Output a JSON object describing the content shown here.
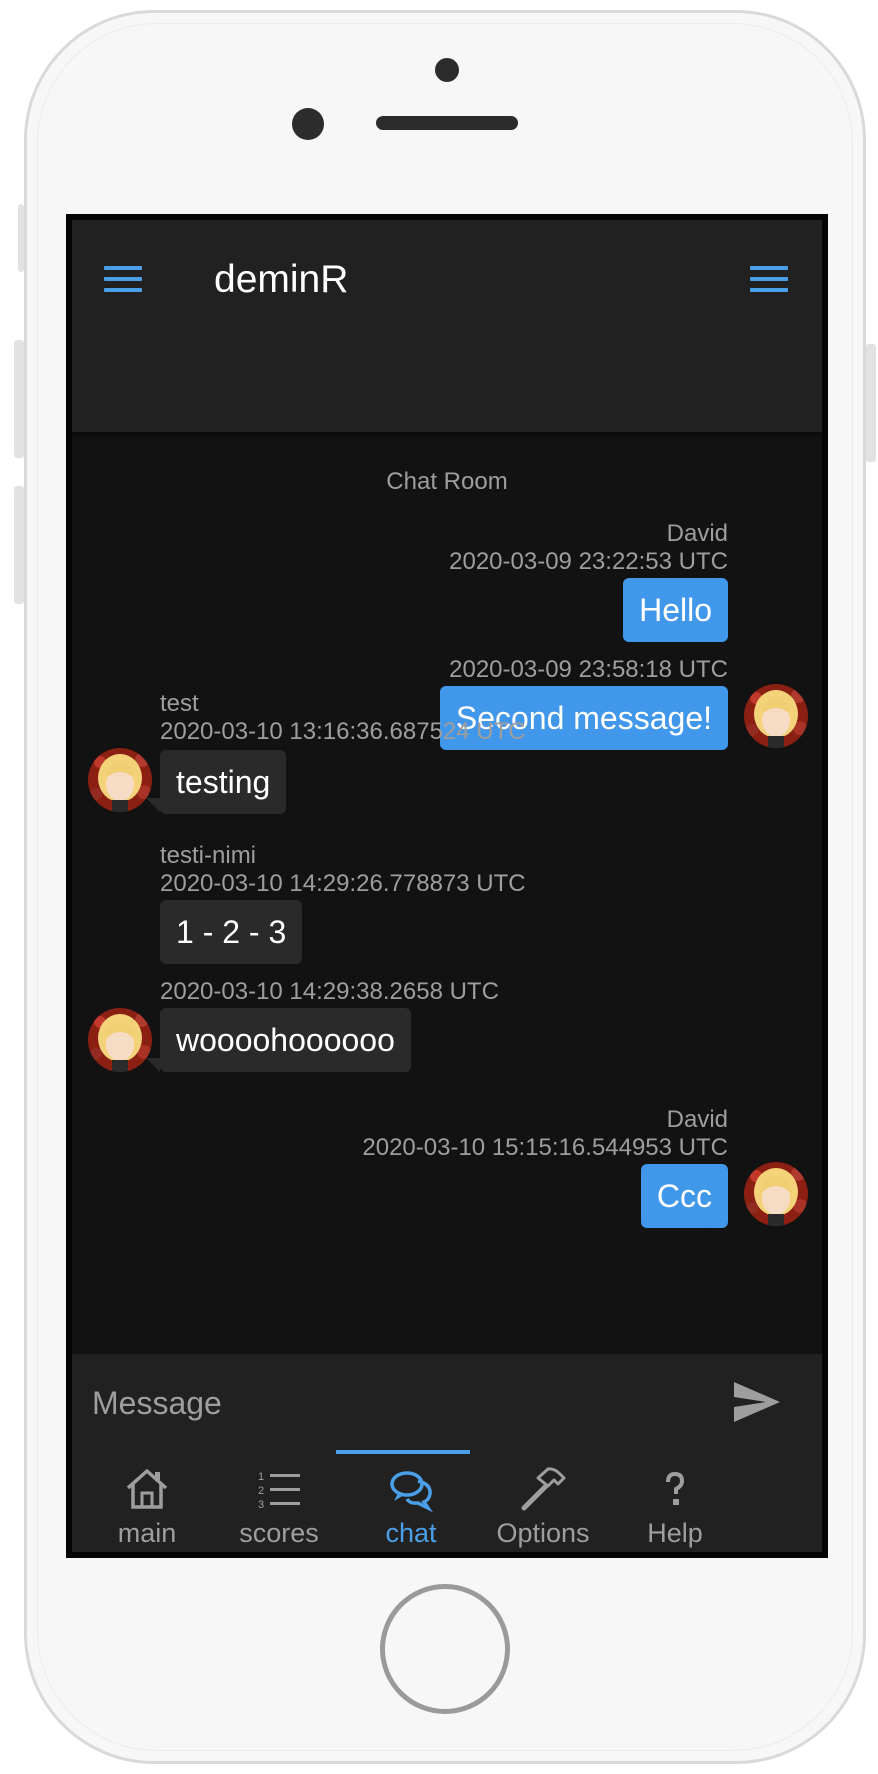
{
  "app": {
    "title": "deminR"
  },
  "chat": {
    "room_title": "Chat Room",
    "messages": [
      {
        "sender": "David",
        "timestamp": "2020-03-09 23:22:53 UTC",
        "text": "Hello",
        "own": true
      },
      {
        "sender": "",
        "timestamp": "2020-03-09 23:58:18 UTC",
        "text": "Second message!",
        "own": true
      },
      {
        "sender": "test",
        "timestamp": "2020-03-10 13:16:36.687524 UTC",
        "text": "testing",
        "own": false
      },
      {
        "sender": "testi-nimi",
        "timestamp": "2020-03-10 14:29:26.778873 UTC",
        "text": "1 - 2 - 3",
        "own": false
      },
      {
        "sender": "",
        "timestamp": "2020-03-10 14:29:38.2658 UTC",
        "text": "woooohoooooo",
        "own": false
      },
      {
        "sender": "David",
        "timestamp": "2020-03-10 15:15:16.544953 UTC",
        "text": "Ccc",
        "own": true
      }
    ]
  },
  "input": {
    "placeholder": "Message",
    "value": ""
  },
  "tabs": [
    {
      "label": "main",
      "icon": "home-icon",
      "active": false
    },
    {
      "label": "scores",
      "icon": "numbered-list-icon",
      "active": false
    },
    {
      "label": "chat",
      "icon": "chat-bubbles-icon",
      "active": true
    },
    {
      "label": "Options",
      "icon": "hammer-icon",
      "active": false
    },
    {
      "label": "Help",
      "icon": "question-mark-icon",
      "active": false
    }
  ],
  "colors": {
    "accent": "#4b9fe8",
    "sent_bubble": "#4197e9",
    "received_bubble": "#2a2a2a",
    "background": "#121212",
    "toolbar": "#212121"
  }
}
